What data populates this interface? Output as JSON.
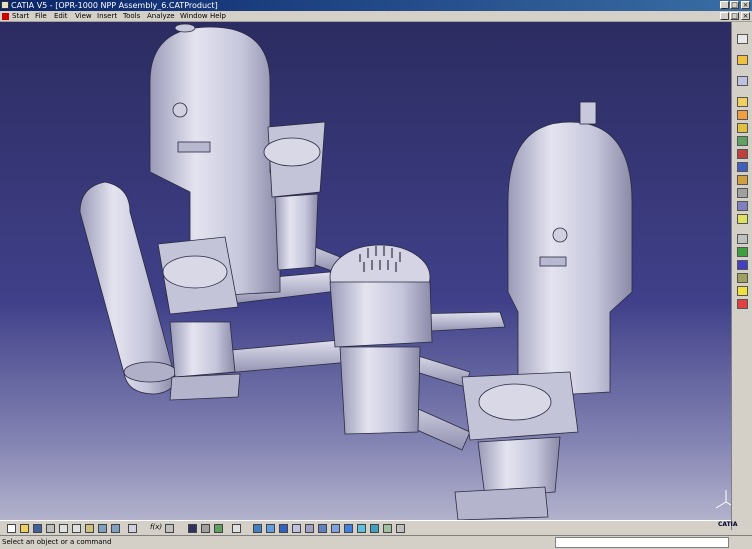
{
  "window": {
    "title": "CATIA V5 - [OPR-1000 NPP Assembly_6.CATProduct]"
  },
  "menu": {
    "items": [
      "Start",
      "File",
      "Edit",
      "View",
      "Insert",
      "Tools",
      "Analyze",
      "Window",
      "Help"
    ]
  },
  "bottom_toolbar": {
    "formula_label": "f(x)"
  },
  "status": {
    "message": "Select an object or a command",
    "command_value": ""
  },
  "logo": {
    "text": "CATIA"
  },
  "icons": {
    "right_toolbar": [
      "select-arrow-icon",
      "sketcher-icon",
      "assembly-icon",
      "new-component-icon",
      "new-product-icon",
      "new-part-icon",
      "existing-component-icon",
      "replace-component-icon",
      "graph-tree-icon",
      "generate-numbering-icon",
      "selective-load-icon",
      "manage-representations-icon",
      "fast-multi-instantiation-icon",
      "defineidentity-icon",
      "explode-icon",
      "stop-manipulate-icon",
      "snap-icon",
      "smart-move-icon",
      "reconnect-icon",
      "catalog-icon",
      "bill-of-material-icon",
      "clash-icon",
      "sectioning-icon",
      "distance-icon",
      "light-icon",
      "update-icon",
      "scenes-icon"
    ],
    "bottom_toolbar": [
      "new-icon",
      "open-icon",
      "save-icon",
      "print-icon",
      "cut-icon",
      "copy-icon",
      "paste-icon",
      "undo-icon",
      "redo-icon",
      "whats-this-icon",
      "formula-icon",
      "knowledge-icon",
      "catalog-browser-icon",
      "measure-icon",
      "fly-mode-icon",
      "fit-all-icon",
      "pan-icon",
      "rotate-icon",
      "zoom-in-icon",
      "zoom-out-icon",
      "normal-view-icon",
      "iso-view-icon",
      "shading-icon",
      "hide-show-icon",
      "swap-space-icon",
      "render-icon"
    ]
  },
  "colors": {
    "title_gradient_start": "#0a246a",
    "viewport_top": "#2c2c62",
    "viewport_bottom": "#b8b8d0",
    "chrome": "#d4d0c8",
    "model_surface": "#c8c8dc"
  }
}
